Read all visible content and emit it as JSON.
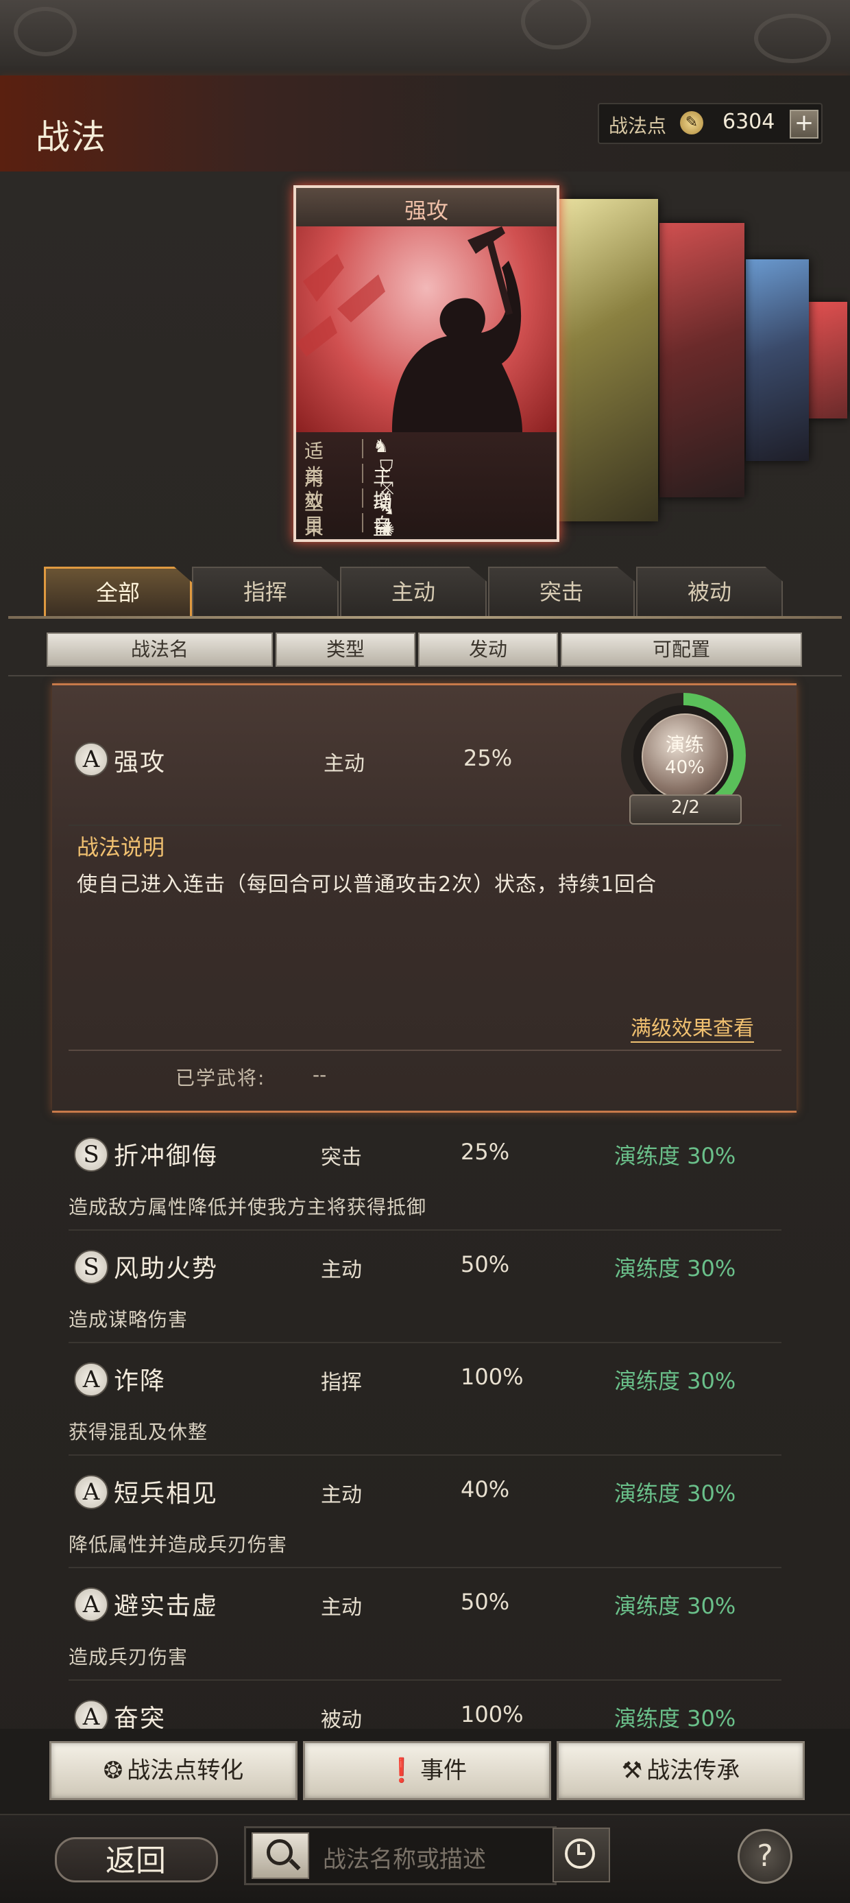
{
  "header": {
    "title": "战法",
    "points_label": "战法点",
    "points_value": "6304",
    "points_add": "+"
  },
  "card": {
    "title": "强攻",
    "info": [
      {
        "key": "适用",
        "value": ""
      },
      {
        "key": "类型",
        "value": "主动"
      },
      {
        "key": "效果",
        "value": "增益"
      },
      {
        "key": "目标",
        "value": "自己"
      }
    ],
    "applicable_icons": [
      "cavalry-icon",
      "shield-icon",
      "bow-icon",
      "spear-icon",
      "wheel-icon"
    ]
  },
  "tabs": [
    {
      "label": "全部",
      "active": true
    },
    {
      "label": "指挥",
      "active": false
    },
    {
      "label": "主动",
      "active": false
    },
    {
      "label": "突击",
      "active": false
    },
    {
      "label": "被动",
      "active": false
    }
  ],
  "columns": [
    "战法名",
    "类型",
    "发动",
    "可配置"
  ],
  "selected": {
    "grade": "A",
    "name": "强攻",
    "type": "主动",
    "rate": "25%",
    "drill_label": "演练",
    "drill_pct": "40%",
    "drill_progress": 0.4,
    "drill_count": "2/2",
    "desc_title": "战法说明",
    "desc_text": "使自己进入连击（每回合可以普通攻击2次）状态，持续1回合",
    "max_link": "满级效果查看",
    "learned_label": "已学武将:",
    "learned_value": "--"
  },
  "skills": [
    {
      "grade": "S",
      "name": "折冲御侮",
      "type": "突击",
      "rate": "25%",
      "prof": "演练度 30%",
      "desc": "造成敌方属性降低并使我方主将获得抵御"
    },
    {
      "grade": "S",
      "name": "风助火势",
      "type": "主动",
      "rate": "50%",
      "prof": "演练度 30%",
      "desc": "造成谋略伤害"
    },
    {
      "grade": "A",
      "name": "诈降",
      "type": "指挥",
      "rate": "100%",
      "prof": "演练度 30%",
      "desc": "获得混乱及休整"
    },
    {
      "grade": "A",
      "name": "短兵相见",
      "type": "主动",
      "rate": "40%",
      "prof": "演练度 30%",
      "desc": "降低属性并造成兵刃伤害"
    },
    {
      "grade": "A",
      "name": "避实击虚",
      "type": "主动",
      "rate": "50%",
      "prof": "演练度 30%",
      "desc": "造成兵刃伤害"
    },
    {
      "grade": "A",
      "name": "奋突",
      "type": "被动",
      "rate": "100%",
      "prof": "演练度 30%",
      "desc": ""
    }
  ],
  "buttons": {
    "convert": "战法点转化",
    "event": "事件",
    "inherit": "战法传承"
  },
  "footer": {
    "back": "返回",
    "search_placeholder": "战法名称或描述",
    "help": "?"
  }
}
